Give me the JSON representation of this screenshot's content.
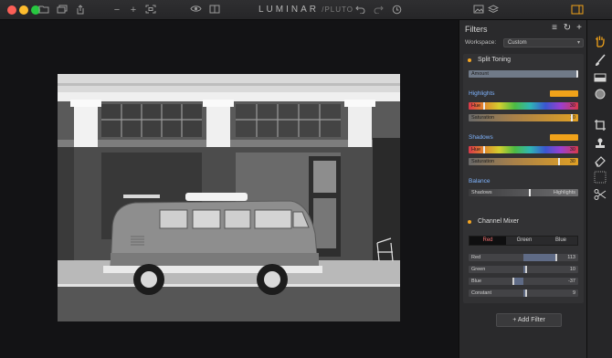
{
  "app": {
    "title": "LUMINAR",
    "title_suffix": "PLUTO"
  },
  "panel": {
    "title": "Filters",
    "workspace_label": "Workspace:",
    "workspace_value": "Custom",
    "add_filter_label": "Add Filter"
  },
  "split_toning": {
    "title": "Split Toning",
    "amount_label": "Amount",
    "highlights": {
      "label": "Highlights",
      "hue_label": "Hue",
      "hue_value": "30",
      "saturation_label": "Saturation",
      "saturation_value": "10"
    },
    "shadows": {
      "label": "Shadows",
      "hue_label": "Hue",
      "hue_value": "30",
      "saturation_label": "Saturation",
      "saturation_value": "30"
    },
    "balance": {
      "label": "Balance",
      "left_label": "Shadows",
      "right_label": "Highlights"
    }
  },
  "channel_mixer": {
    "title": "Channel Mixer",
    "tabs": [
      "Red",
      "Green",
      "Blue"
    ],
    "active_tab": "Red",
    "rows": [
      {
        "label": "Red",
        "value": "113"
      },
      {
        "label": "Green",
        "value": "10"
      },
      {
        "label": "Blue",
        "value": "-37"
      },
      {
        "label": "Constant",
        "value": "9"
      }
    ]
  },
  "colors": {
    "accent": "#f5a623",
    "section_label": "#7fb4ff",
    "active_tab_text": "#f07070"
  },
  "icons": {
    "titlebar_left": [
      "folder-icon",
      "layers-icon",
      "share-icon",
      "minus-icon",
      "plus-icon",
      "fit-icon",
      "eye-icon",
      "compare-icon"
    ],
    "titlebar_right": [
      "undo-icon",
      "redo-icon",
      "history-icon",
      "image-icon",
      "stack-icon"
    ],
    "tools": [
      "hand-icon",
      "brush-icon",
      "gradient-icon",
      "radial-icon",
      "crop-icon",
      "clone-stamp-icon",
      "eraser-icon",
      "noise-icon",
      "transform-icon"
    ]
  }
}
